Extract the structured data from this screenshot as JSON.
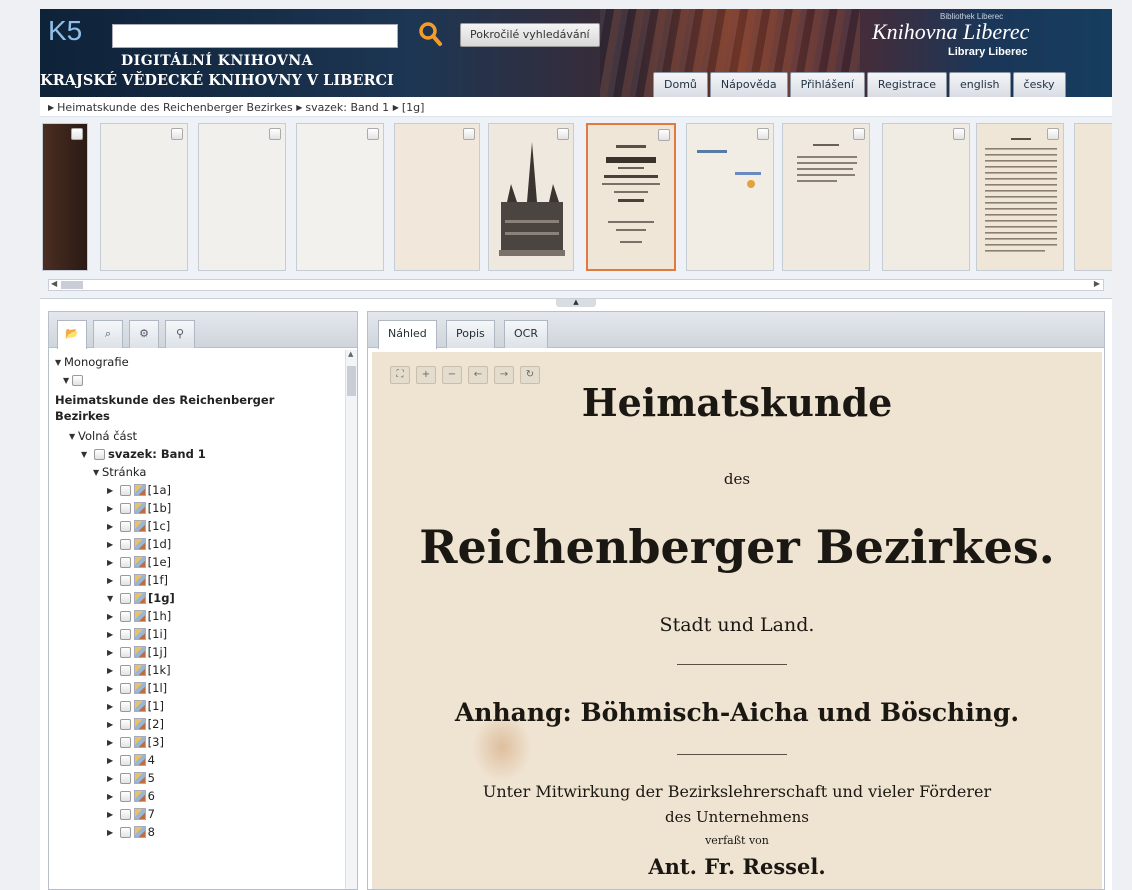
{
  "header": {
    "logo": "K5",
    "search_placeholder": "",
    "advanced_search_label": "Pokročilé vyhledávání",
    "title_line1": "DIGITÁLNÍ KNIHOVNA",
    "title_line2": "KRAJSKÉ VĚDECKÉ KNIHOVNY V LIBERCI",
    "brand_small": "Bibliothek Liberec",
    "brand_main": "Knihovna Liberec",
    "brand_sub": "Library Liberec",
    "nav": [
      "Domů",
      "Nápověda",
      "Přihlášení",
      "Registrace",
      "english",
      "česky"
    ]
  },
  "breadcrumb": {
    "items": [
      "Heimatskunde des Reichenberger Bezirkes",
      "svazek: Band 1",
      "[1g]"
    ]
  },
  "thumbnails": {
    "count": 12,
    "selected_index": 6
  },
  "left_panel": {
    "tab_icons": [
      "folder-icon",
      "search-icon",
      "gear-icon",
      "pin-icon"
    ],
    "tree": {
      "root": "Monografie",
      "title": "Heimatskunde des Reichenberger Bezirkes",
      "part": "Volná část",
      "volume": "svazek: Band 1",
      "page_group": "Stránka",
      "pages": [
        "[1a]",
        "[1b]",
        "[1c]",
        "[1d]",
        "[1e]",
        "[1f]",
        "[1g]",
        "[1h]",
        "[1i]",
        "[1j]",
        "[1k]",
        "[1l]",
        "[1]",
        "[2]",
        "[3]",
        "4",
        "5",
        "6",
        "7",
        "8"
      ],
      "selected_page": "[1g]"
    }
  },
  "right_panel": {
    "tabs": [
      "Náhled",
      "Popis",
      "OCR"
    ],
    "active_tab": "Náhled",
    "toolbar_icons": [
      "fit-icon",
      "zoom-in-icon",
      "zoom-out-icon",
      "arrow-left-icon",
      "arrow-right-icon",
      "rotate-icon"
    ],
    "page": {
      "line1": "Heimatskunde",
      "line2": "des",
      "line3": "Reichenberger Bezirkes.",
      "line4": "Stadt und Land.",
      "line5": "Anhang: Böhmisch-Aicha und Bösching.",
      "line6": "Unter Mitwirkung der Bezirkslehrerschaft und vieler Förderer",
      "line7": "des Unternehmens",
      "line8": "verfaßt von",
      "line9": "Ant. Fr. Ressel."
    }
  }
}
